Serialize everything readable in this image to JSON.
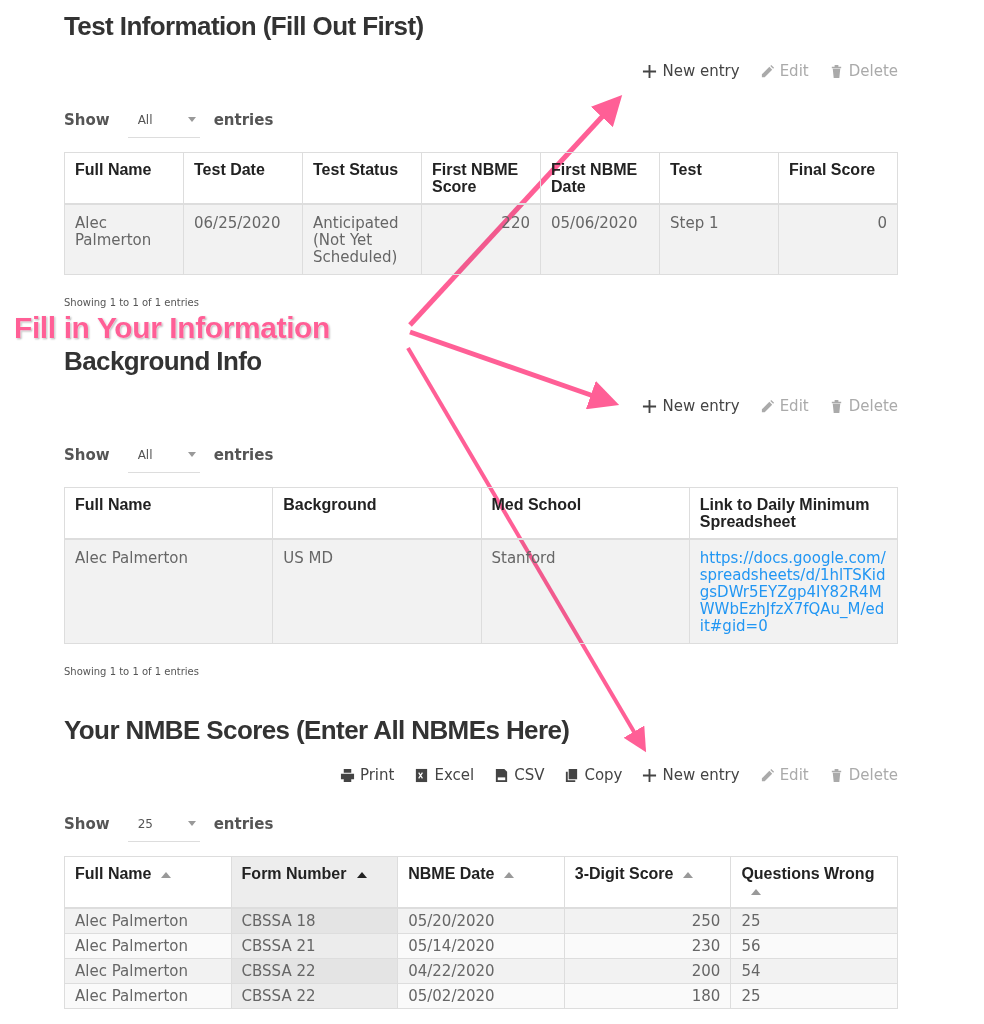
{
  "sections": [
    {
      "title": "Test Information (Fill Out First)",
      "toolbar": [
        {
          "kind": "new",
          "label": "New entry",
          "disabled": false
        },
        {
          "kind": "edit",
          "label": "Edit",
          "disabled": true
        },
        {
          "kind": "delete",
          "label": "Delete",
          "disabled": true
        }
      ],
      "length": {
        "before": "Show",
        "value": "All",
        "after": "entries"
      },
      "columns": [
        {
          "label": "Full Name",
          "kind": "text"
        },
        {
          "label": "Test Date",
          "kind": "text"
        },
        {
          "label": "Test Status",
          "kind": "text"
        },
        {
          "label": "First NBME Score",
          "kind": "number"
        },
        {
          "label": "First NBME Date",
          "kind": "text"
        },
        {
          "label": "Test",
          "kind": "text"
        },
        {
          "label": "Final Score",
          "kind": "number"
        }
      ],
      "rows": [
        [
          "Alec Palmerton",
          "06/25/2020",
          "Anticipated (Not Yet Scheduled)",
          "220",
          "05/06/2020",
          "Step 1",
          "0"
        ]
      ],
      "info": "Showing 1 to 1 of 1 entries"
    },
    {
      "title": "Background Info",
      "toolbar": [
        {
          "kind": "new",
          "label": "New entry",
          "disabled": false
        },
        {
          "kind": "edit",
          "label": "Edit",
          "disabled": true
        },
        {
          "kind": "delete",
          "label": "Delete",
          "disabled": true
        }
      ],
      "length": {
        "before": "Show",
        "value": "All",
        "after": "entries"
      },
      "columns": [
        {
          "label": "Full Name",
          "kind": "text"
        },
        {
          "label": "Background",
          "kind": "text"
        },
        {
          "label": "Med School",
          "kind": "text"
        },
        {
          "label": "Link to Daily Minimum Spreadsheet",
          "kind": "link"
        }
      ],
      "rows": [
        [
          "Alec Palmerton",
          "US MD",
          "Stanford",
          "https://docs.google.com/spreadsheets/d/1hlTSKidgsDWr5EYZgp4IY82R4MWWbEzhJfzX7fQAu_M/edit#gid=0"
        ]
      ],
      "info": "Showing 1 to 1 of 1 entries"
    },
    {
      "title": "Your NMBE Scores (Enter All NBMEs Here)",
      "toolbar": [
        {
          "kind": "print",
          "label": "Print",
          "disabled": false
        },
        {
          "kind": "excel",
          "label": "Excel",
          "disabled": false
        },
        {
          "kind": "csv",
          "label": "CSV",
          "disabled": false
        },
        {
          "kind": "copy",
          "label": "Copy",
          "disabled": false
        },
        {
          "kind": "new",
          "label": "New entry",
          "disabled": false
        },
        {
          "kind": "edit",
          "label": "Edit",
          "disabled": true
        },
        {
          "kind": "delete",
          "label": "Delete",
          "disabled": true
        }
      ],
      "length": {
        "before": "Show",
        "value": "25",
        "after": "entries"
      },
      "columns": [
        {
          "label": "Full Name",
          "kind": "text",
          "sortable": true,
          "sorted": false
        },
        {
          "label": "Form Number",
          "kind": "text",
          "sortable": true,
          "sorted": true
        },
        {
          "label": "NBME Date",
          "kind": "text",
          "sortable": true,
          "sorted": false
        },
        {
          "label": "3-Digit Score",
          "kind": "number",
          "sortable": true,
          "sorted": false
        },
        {
          "label": "Questions Wrong",
          "kind": "text",
          "sortable": true,
          "sorted": false
        }
      ],
      "rows": [
        [
          "Alec Palmerton",
          "CBSSA 18",
          "05/20/2020",
          "250",
          "25"
        ],
        [
          "Alec Palmerton",
          "CBSSA 21",
          "05/14/2020",
          "230",
          "56"
        ],
        [
          "Alec Palmerton",
          "CBSSA 22",
          "04/22/2020",
          "200",
          "54"
        ],
        [
          "Alec Palmerton",
          "CBSSA 22",
          "05/02/2020",
          "180",
          "25"
        ]
      ]
    }
  ],
  "annotation": {
    "text": "Fill in Your Information"
  }
}
